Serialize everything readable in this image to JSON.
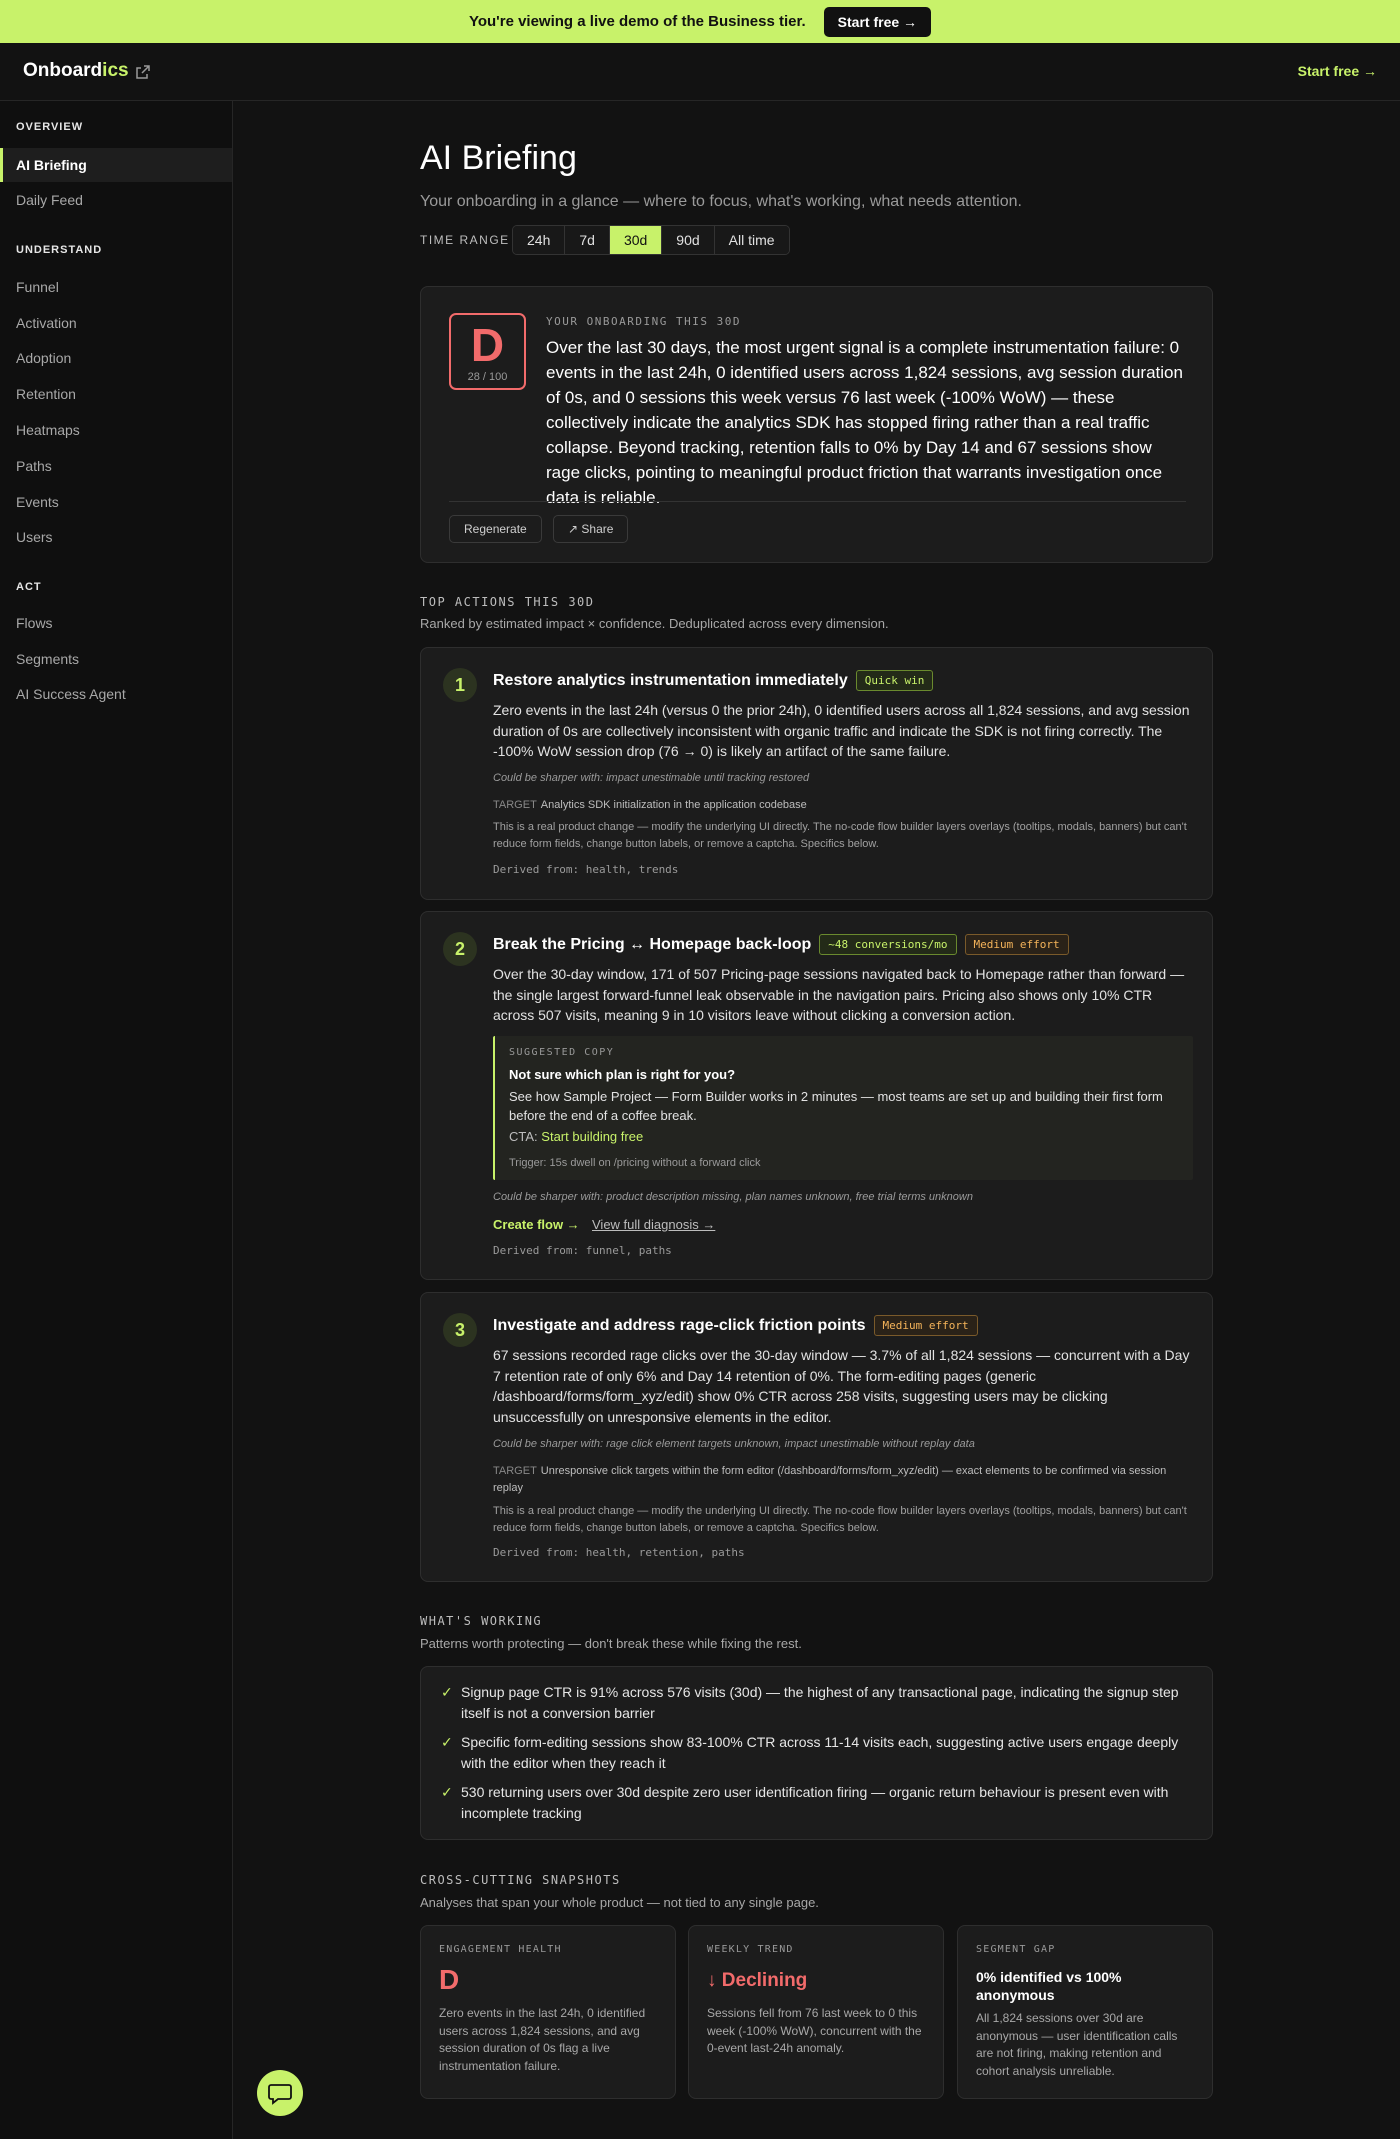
{
  "banner": {
    "text": "You're viewing a live demo of the Business tier.",
    "button": "Start free →"
  },
  "header": {
    "logo_main": "Onboard",
    "logo_accent": "ics",
    "cta": "Start free →"
  },
  "sidebar": {
    "sections": [
      {
        "title": "OVERVIEW",
        "items": [
          "AI Briefing",
          "Daily Feed"
        ]
      },
      {
        "title": "UNDERSTAND",
        "items": [
          "Funnel",
          "Activation",
          "Adoption",
          "Retention",
          "Heatmaps",
          "Paths",
          "Events",
          "Users"
        ]
      },
      {
        "title": "ACT",
        "items": [
          "Flows",
          "Segments",
          "AI Success Agent"
        ]
      }
    ],
    "active": "AI Briefing"
  },
  "page": {
    "title": "AI Briefing",
    "subtitle": "Your onboarding in a glance — where to focus, what's working, what needs attention.",
    "range_label": "TIME RANGE",
    "ranges": [
      "24h",
      "7d",
      "30d",
      "90d",
      "All time"
    ],
    "active_range": "30d"
  },
  "summary": {
    "grade": "D",
    "score": "28 / 100",
    "label": "YOUR ONBOARDING THIS 30D",
    "text": "Over the last 30 days, the most urgent signal is a complete instrumentation failure: 0 events in the last 24h, 0 identified users across 1,824 sessions, avg session duration of 0s, and 0 sessions this week versus 76 last week (-100% WoW) — these collectively indicate the analytics SDK has stopped firing rather than a real traffic collapse. Beyond tracking, retention falls to 0% by Day 14 and 67 sessions show rage clicks, pointing to meaningful product friction that warrants investigation once data is reliable.",
    "regenerate": "Regenerate",
    "share": "↗ Share"
  },
  "actions_section": {
    "label": "TOP ACTIONS THIS 30D",
    "sub": "Ranked by estimated impact × confidence. Deduplicated across every dimension."
  },
  "actions": [
    {
      "num": "1",
      "title": "Restore analytics instrumentation immediately",
      "tags": [
        "Quick win"
      ],
      "body": "Zero events in the last 24h (versus 0 the prior 24h), 0 identified users across all 1,824 sessions, and avg session duration of 0s are collectively inconsistent with organic traffic and indicate the SDK is not firing correctly. The -100% WoW session drop (76 → 0) is likely an artifact of the same failure.",
      "note": "Could be sharper with: impact unestimable until tracking restored",
      "target_label": "TARGET",
      "target": "Analytics SDK initialization in the application codebase",
      "real": "This is a real product change — modify the underlying UI directly. The no-code flow builder layers overlays (tooltips, modals, banners) but can't reduce form fields, change button labels, or remove a captcha. Specifics below.",
      "derived": "Derived from: health, trends"
    },
    {
      "num": "2",
      "title": "Break the Pricing ↔ Homepage back-loop",
      "tags": [
        "~48 conversions/mo",
        "Medium effort"
      ],
      "body": "Over the 30-day window, 171 of 507 Pricing-page sessions navigated back to Homepage rather than forward — the single largest forward-funnel leak observable in the navigation pairs. Pricing also shows only 10% CTR across 507 visits, meaning 9 in 10 visitors leave without clicking a conversion action.",
      "copy": {
        "label": "SUGGESTED COPY",
        "headline": "Not sure which plan is right for you?",
        "body": "See how Sample Project — Form Builder works in 2 minutes — most teams are set up and building their first form before the end of a coffee break.",
        "cta_label": "CTA:",
        "cta": "Start building free",
        "trigger": "Trigger: 15s dwell on /pricing without a forward click"
      },
      "note": "Could be sharper with: product description missing, plan names unknown, free trial terms unknown",
      "create_link": "Create flow →",
      "diag_link": "View full diagnosis →",
      "derived": "Derived from: funnel, paths"
    },
    {
      "num": "3",
      "title": "Investigate and address rage-click friction points",
      "tags": [
        "Medium effort"
      ],
      "body": "67 sessions recorded rage clicks over the 30-day window — 3.7% of all 1,824 sessions — concurrent with a Day 7 retention rate of only 6% and Day 14 retention of 0%. The form-editing pages (generic /dashboard/forms/form_xyz/edit) show 0% CTR across 258 visits, suggesting users may be clicking unsuccessfully on unresponsive elements in the editor.",
      "note": "Could be sharper with: rage click element targets unknown, impact unestimable without replay data",
      "target_label": "TARGET",
      "target": "Unresponsive click targets within the form editor (/dashboard/forms/form_xyz/edit) — exact elements to be confirmed via session replay",
      "real": "This is a real product change — modify the underlying UI directly. The no-code flow builder layers overlays (tooltips, modals, banners) but can't reduce form fields, change button labels, or remove a captcha. Specifics below.",
      "derived": "Derived from: health, retention, paths"
    }
  ],
  "working": {
    "label": "WHAT'S WORKING",
    "sub": "Patterns worth protecting — don't break these while fixing the rest.",
    "items": [
      "Signup page CTR is 91% across 576 visits (30d) — the highest of any transactional page, indicating the signup step itself is not a conversion barrier",
      "Specific form-editing sessions show 83-100% CTR across 11-14 visits each, suggesting active users engage deeply with the editor when they reach it",
      "530 returning users over 30d despite zero user identification firing — organic return behaviour is present even with incomplete tracking"
    ]
  },
  "snapshots": {
    "label": "CROSS-CUTTING SNAPSHOTS",
    "sub": "Analyses that span your whole product — not tied to any single page.",
    "items": [
      {
        "label": "ENGAGEMENT HEALTH",
        "value": "D",
        "text": "Zero events in the last 24h, 0 identified users across 1,824 sessions, and avg session duration of 0s flag a live instrumentation failure."
      },
      {
        "label": "WEEKLY TREND",
        "value": "↓ Declining",
        "text": "Sessions fell from 76 last week to 0 this week (-100% WoW), concurrent with the 0-event last-24h anomaly."
      },
      {
        "label": "SEGMENT GAP",
        "value": "0% identified vs 100% anonymous",
        "text": "All 1,824 sessions over 30d are anonymous — user identification calls are not firing, making retention and cohort analysis unreliable."
      }
    ]
  },
  "colors": {
    "accent": "#c8f26a",
    "grade_red": "#f26b6b",
    "effort_orange": "#f5b45a"
  },
  "icons": {
    "external": "external-link-icon",
    "chat": "chat-bubble-icon",
    "check": "check-icon"
  }
}
